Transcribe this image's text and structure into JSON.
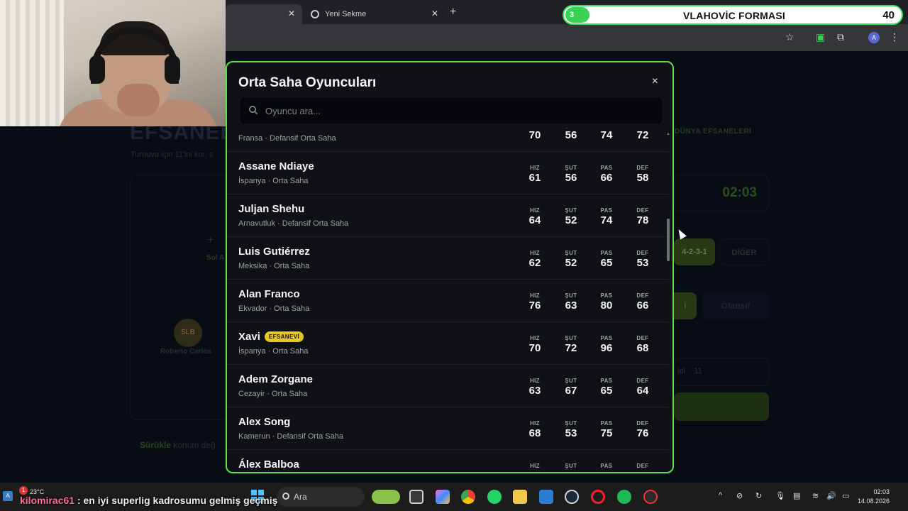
{
  "browser": {
    "tabs": [
      {
        "label": "",
        "active": true
      },
      {
        "label": "Yeni Sekme",
        "active": false
      }
    ],
    "new_tab_symbol": "+",
    "profile_initial": "A"
  },
  "stream_overlay": {
    "goal_count_start": "3",
    "title": "VLAHOVİC FORMASI",
    "goal_count_end": "40"
  },
  "background_page": {
    "heading": "EFSANEL",
    "subtitle": "Turnuva için 11'ini kur, s",
    "slot_plus": "+",
    "slot_label": "Sol A",
    "player_badge": "SLB",
    "player_name": "Roberto Carlos",
    "drag_hint_bold": "Sürükle",
    "drag_hint_rest": "konum değ",
    "right_chip": "DÜNYA EFSANELERİ",
    "timer": "02:03",
    "formation_selected": "4-2-3-1",
    "formation_other": "DİĞER",
    "style_selected": "i",
    "style_other": "Ofansif",
    "selected_label": "ldi",
    "selected_count": "11"
  },
  "modal": {
    "title": "Orta Saha Oyuncuları",
    "close_symbol": "×",
    "search_placeholder": "Oyuncu ara...",
    "stat_labels": {
      "hiz": "HIZ",
      "sut": "ŞUT",
      "pas": "PAS",
      "def": "DEF"
    },
    "players": [
      {
        "name": "",
        "meta": "Fransa · Defansif Orta Saha",
        "hiz": "70",
        "sut": "56",
        "pas": "74",
        "def": "72",
        "badge": ""
      },
      {
        "name": "Assane Ndiaye",
        "meta": "İspanya · Orta Saha",
        "hiz": "61",
        "sut": "56",
        "pas": "66",
        "def": "58",
        "badge": ""
      },
      {
        "name": "Juljan Shehu",
        "meta": "Arnavutluk · Defansif Orta Saha",
        "hiz": "64",
        "sut": "52",
        "pas": "74",
        "def": "78",
        "badge": ""
      },
      {
        "name": "Luis Gutiérrez",
        "meta": "Meksika · Orta Saha",
        "hiz": "62",
        "sut": "52",
        "pas": "65",
        "def": "53",
        "badge": ""
      },
      {
        "name": "Alan Franco",
        "meta": "Ekvador · Orta Saha",
        "hiz": "76",
        "sut": "63",
        "pas": "80",
        "def": "66",
        "badge": ""
      },
      {
        "name": "Xavi",
        "meta": "İspanya · Orta Saha",
        "hiz": "70",
        "sut": "72",
        "pas": "96",
        "def": "68",
        "badge": "EFSANEVİ"
      },
      {
        "name": "Adem Zorgane",
        "meta": "Cezayir · Orta Saha",
        "hiz": "63",
        "sut": "67",
        "pas": "65",
        "def": "64",
        "badge": ""
      },
      {
        "name": "Alex Song",
        "meta": "Kamerun · Defansif Orta Saha",
        "hiz": "68",
        "sut": "53",
        "pas": "75",
        "def": "76",
        "badge": ""
      },
      {
        "name": "Álex Balboa",
        "meta": "",
        "hiz": "",
        "sut": "",
        "pas": "",
        "def": "",
        "badge": ""
      }
    ]
  },
  "taskbar": {
    "weather_badge": "1",
    "weather_temp": "23°C",
    "chat_user": "kilomirac61",
    "chat_message": ": en iyi superlig kadrosumu gelmiş geçmiş",
    "search_label": "Ara",
    "time": "02:03",
    "date": "14.08.2026"
  },
  "colors": {
    "accent_green": "#5fe04a",
    "badge_yellow": "#e8c81e",
    "modal_bg": "#0f1116"
  }
}
